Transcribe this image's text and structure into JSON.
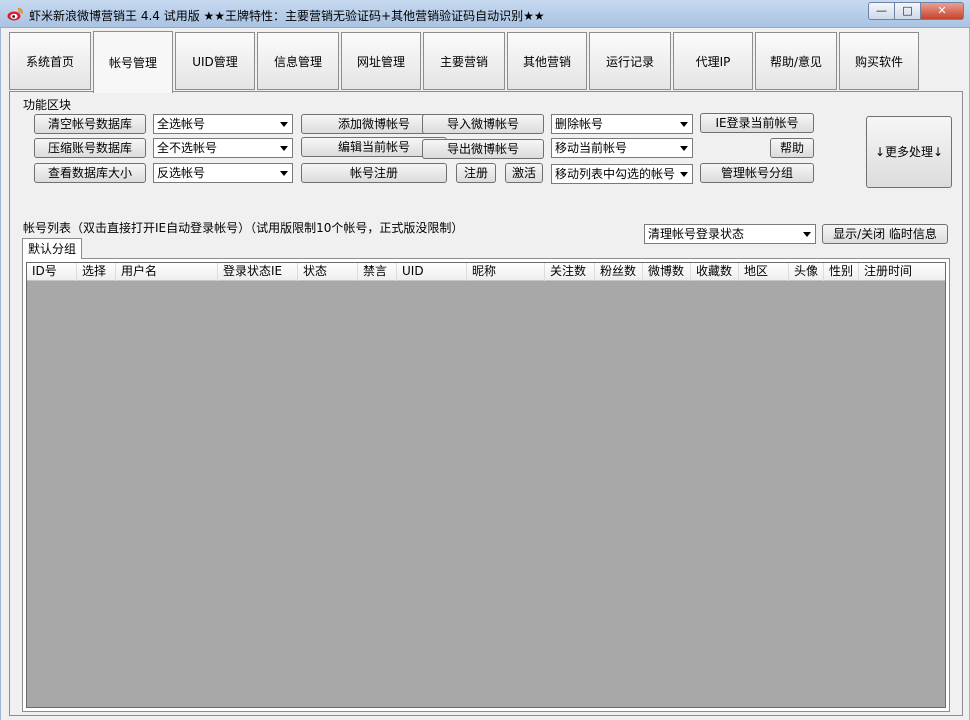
{
  "window": {
    "title": "虾米新浪微博营销王 4.4 试用版   ★★王牌特性：主要营销无验证码+其他营销验证码自动识别★★",
    "minimize": "—",
    "maximize": "□",
    "close": "✕"
  },
  "tabs": [
    "系统首页",
    "帐号管理",
    "UID管理",
    "信息管理",
    "网址管理",
    "主要营销",
    "其他营销",
    "运行记录",
    "代理IP",
    "帮助/意见",
    "购买软件"
  ],
  "active_tab": "帐号管理",
  "function_group": {
    "label": "功能区块",
    "clear_db": "清空帐号数据库",
    "compress_db": "压缩账号数据库",
    "view_db_size": "查看数据库大小",
    "select_all": "全选帐号",
    "select_none": "全不选帐号",
    "invert_select": "反选帐号",
    "add_account": "添加微博帐号",
    "edit_account": "编辑当前帐号",
    "register_account": "帐号注册",
    "import_accounts": "导入微博帐号",
    "export_accounts": "导出微博帐号",
    "register": "注册",
    "activate": "激活",
    "delete_account": "删除帐号",
    "move_current": "移动当前帐号",
    "move_checked": "移动列表中勾选的帐号",
    "ie_login": "IE登录当前帐号",
    "help": "帮助",
    "manage_groups": "管理帐号分组",
    "more_actions": "↓更多处理↓"
  },
  "account_list": {
    "label": "帐号列表（双击直接打开IE自动登录帐号）（试用版限制10个帐号，正式版没限制）",
    "clear_login_state": "清理帐号登录状态",
    "toggle_temp_info": "显示/关闭 临时信息",
    "group_tab": "默认分组",
    "columns": [
      "ID号",
      "选择",
      "用户名",
      "登录状态IE",
      "状态",
      "禁言",
      "UID",
      "昵称",
      "关注数",
      "粉丝数",
      "微博数",
      "收藏数",
      "地区",
      "头像",
      "性别",
      "注册时间"
    ]
  }
}
